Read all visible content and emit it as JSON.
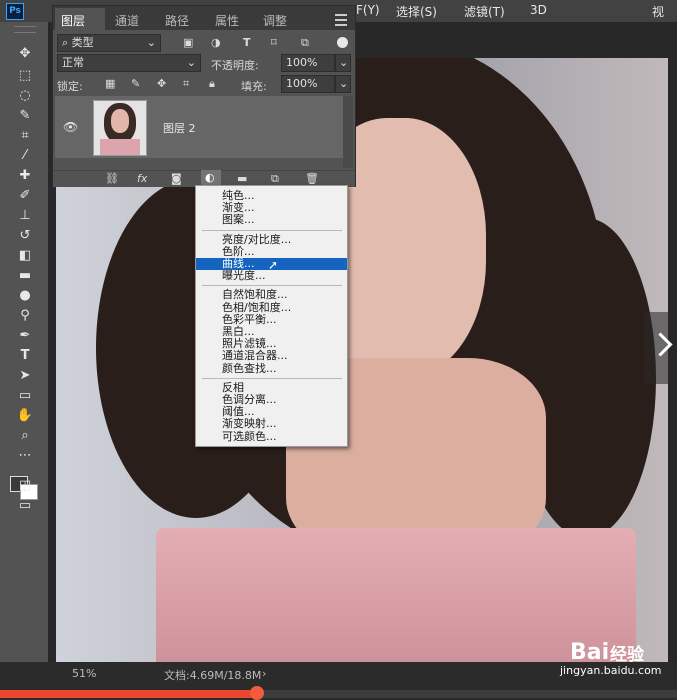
{
  "app": {
    "logo": "Ps"
  },
  "menubar": {
    "items": [
      "F(Y)",
      "选择(S)",
      "滤镜(T)",
      "3D",
      "视"
    ]
  },
  "layers_panel": {
    "tabs": [
      "图层",
      "通道",
      "路径",
      "属性",
      "调整"
    ],
    "active_tab": "图层",
    "filter_kind": "类型",
    "blend_mode": "正常",
    "opacity_label": "不透明度:",
    "opacity_value": "100%",
    "lock_label": "锁定:",
    "fill_label": "填充:",
    "fill_value": "100%",
    "layers": [
      {
        "name": "图层 2",
        "visible": true
      }
    ],
    "bottom_fx": "fx"
  },
  "adjustment_menu": {
    "groups": [
      [
        "纯色...",
        "渐变...",
        "图案..."
      ],
      [
        "亮度/对比度...",
        "色阶...",
        "曲线...",
        "曝光度..."
      ],
      [
        "自然饱和度...",
        "色相/饱和度...",
        "色彩平衡...",
        "黑白...",
        "照片滤镜...",
        "通道混合器...",
        "颜色查找..."
      ],
      [
        "反相",
        "色调分离...",
        "阈值...",
        "渐变映射...",
        "可选颜色..."
      ]
    ],
    "selected": "曲线..."
  },
  "statusbar": {
    "zoom": "51%",
    "doc_info": "文档:4.69M/18.8M",
    "arrow": "›"
  },
  "watermark": {
    "brand": "Bai",
    "brand_suffix": "经验",
    "url": "jingyan.baidu.com"
  },
  "video_progress": 0.38,
  "colors": {
    "accent_selected": "#1565c0",
    "progress": "#e9452f",
    "panel": "#535353"
  }
}
